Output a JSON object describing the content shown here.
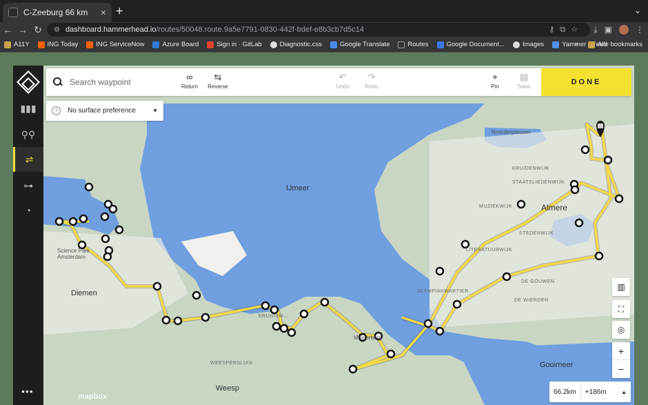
{
  "browser": {
    "tab_title": "C-Zeeburg 66 km",
    "url_domain": "dashboard.hammerhead.io",
    "url_path": "/routes/50048.route.9a5e7791-0830-442f-bdef-e8b3cb7d5c14",
    "bookmarks": [
      "A11Y",
      "ING Today",
      "ING ServiceNow",
      "Azure Board",
      "Sign in · GitLab",
      "Diagnostic.css",
      "Google Translate",
      "Routes",
      "Google Document...",
      "Images",
      "Yammer - Feed"
    ],
    "all_bookmarks": "Alle bookmarks"
  },
  "toolbar": {
    "search_placeholder": "Search waypoint",
    "return_label": "Return",
    "reverse_label": "Reverse",
    "undo_label": "Undo",
    "redo_label": "Redo",
    "pin_label": "Pin",
    "save_label": "Save",
    "done_label": "DONE"
  },
  "surface": {
    "selected": "No surface preference"
  },
  "stats": {
    "distance": "66.2km",
    "elevation": "+186m"
  },
  "map_labels": {
    "ijmeer": "IJmeer",
    "almere": "Almere",
    "diemen": "Diemen",
    "gooimeer": "Gooimeer",
    "noorderplassen": "Noorderplassen",
    "weesp": "Weesp",
    "muiderberg": "Muiderberg",
    "science_park": "Science Park Amsterdam",
    "kruidenwijk": "KRUIDENWIJK",
    "staatsliedenwijk": "STAATSLIEDENWIJK",
    "muziekwijk": "MUZIEKWIJK",
    "stedenwijk": "STEDENWIJK",
    "literatuurwijk": "LITERATUURWIJK",
    "olympiakwartier": "OLYMPIAKWARTIER",
    "de_gouwen": "DE GOUWEN",
    "de_wierden": "DE WIERDEN",
    "kruidsmolen": "KRUIDSM...",
    "weesperseluis": "WEESPERSLUIS",
    "attribution": "mapbox"
  },
  "colors": {
    "water": "#6f9fdf",
    "land": "#c9d6c4",
    "route": "#f2d94a",
    "accent": "#f4e12f"
  }
}
